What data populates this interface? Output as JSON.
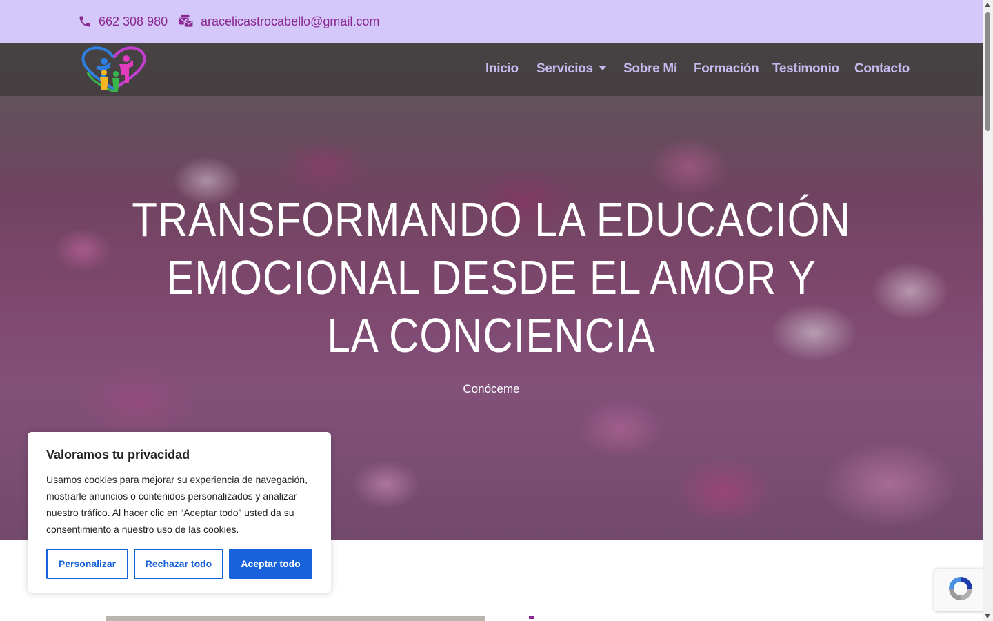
{
  "topbar": {
    "phone": "662 308 980",
    "email": "aracelicastrocabello@gmail.com",
    "phone_icon": "phone-icon",
    "email_icon": "mail-bulk-icon",
    "background": "#d4c8fb",
    "text_color": "#8a2790"
  },
  "nav": {
    "logo": "family-heart-logo",
    "items": [
      {
        "label": "Inicio"
      },
      {
        "label": "Servicios",
        "has_dropdown": true
      },
      {
        "label": "Sobre Mí"
      },
      {
        "label": "Formación"
      },
      {
        "label": "Testimonio"
      },
      {
        "label": "Contacto"
      }
    ],
    "text_color": "#c7b9ee"
  },
  "hero": {
    "title_lines": [
      "TRANSFORMANDO LA EDUCACIÓN",
      "EMOCIONAL DESDE EL AMOR Y",
      "LA CONCIENCIA"
    ],
    "cta": "Conóceme"
  },
  "cookie_banner": {
    "title": "Valoramos tu privacidad",
    "text": "Usamos cookies para mejorar su experiencia de navegación, mostrarle anuncios o contenidos personalizados y analizar nuestro tráfico. Al hacer clic en “Aceptar todo” usted da su consentimiento a nuestro uso de las cookies.",
    "buttons": {
      "customize": "Personalizar",
      "reject": "Rechazar todo",
      "accept": "Aceptar todo"
    },
    "accent": "#1863dc"
  },
  "recaptcha": {
    "icon": "recaptcha-icon"
  }
}
